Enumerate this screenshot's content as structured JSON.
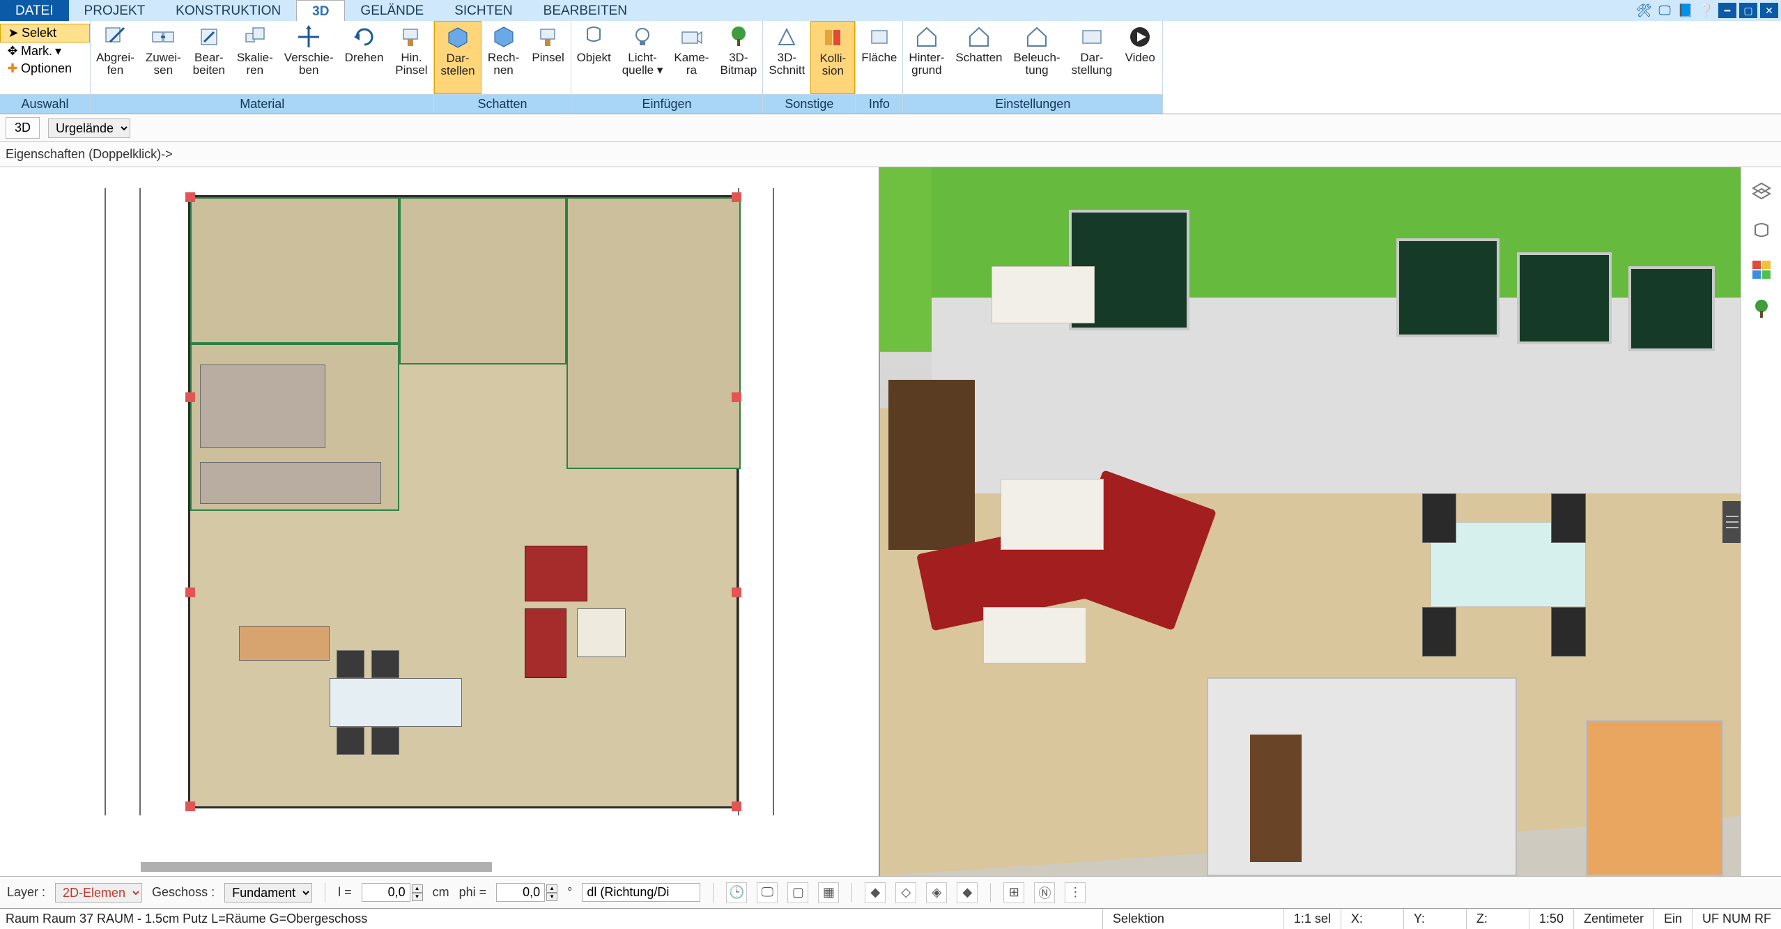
{
  "menu": {
    "tabs": [
      "DATEI",
      "PROJEKT",
      "KONSTRUKTION",
      "3D",
      "GELÄNDE",
      "SICHTEN",
      "BEARBEITEN"
    ],
    "active_index": 3
  },
  "ribbon": {
    "selection_group": {
      "label": "Auswahl",
      "btns": {
        "selekt": "Selekt",
        "mark": "Mark.",
        "optionen": "Optionen"
      }
    },
    "material_group": {
      "label": "Material",
      "btns": [
        "Abgrei-\nfen",
        "Zuwei-\nsen",
        "Bear-\nbeiten",
        "Skalie-\nren",
        "Verschie-\nben",
        "Drehen",
        "Hin.\nPinsel"
      ]
    },
    "schatten_group": {
      "label": "Schatten",
      "btns": [
        "Dar-\nstellen",
        "Rech-\nnen",
        "Pinsel"
      ]
    },
    "einfuegen_group": {
      "label": "Einfügen",
      "btns": [
        "Objekt",
        "Licht-\nquelle ▾",
        "Kame-\nra",
        "3D-\nBitmap"
      ]
    },
    "sonstige_group": {
      "label": "Sonstige",
      "btns": [
        "3D-\nSchnitt",
        "Kolli-\nsion"
      ]
    },
    "info_group": {
      "label": "Info",
      "btns": [
        "Fläche"
      ]
    },
    "einstellungen_group": {
      "label": "Einstellungen",
      "btns": [
        "Hinter-\ngrund",
        "Schatten",
        "Beleuch-\ntung",
        "Dar-\nstellung",
        "Video"
      ]
    }
  },
  "subtoolbar": {
    "mode": "3D",
    "layer_selector": "Urgelände"
  },
  "propbar": {
    "text": "Eigenschaften (Doppelklick)->"
  },
  "bottom": {
    "layer_label": "Layer :",
    "layer_value": "2D-Elemen",
    "geschoss_label": "Geschoss :",
    "geschoss_value": "Fundament",
    "l_label": "l  =",
    "l_value": "0,0",
    "cm": "cm",
    "phi_label": "phi  =",
    "phi_value": "0,0",
    "deg": "°",
    "dl": "dl (Richtung/Di"
  },
  "status": {
    "left": "Raum Raum 37 RAUM  -  1.5cm Putz L=Räume G=Obergeschoss",
    "selektion": "Selektion",
    "ratio": "1:1 sel",
    "X": "X:",
    "Y": "Y:",
    "Z": "Z:",
    "scale": "1:50",
    "unit": "Zentimeter",
    "ein": "Ein",
    "modes": "UF NUM RF"
  }
}
